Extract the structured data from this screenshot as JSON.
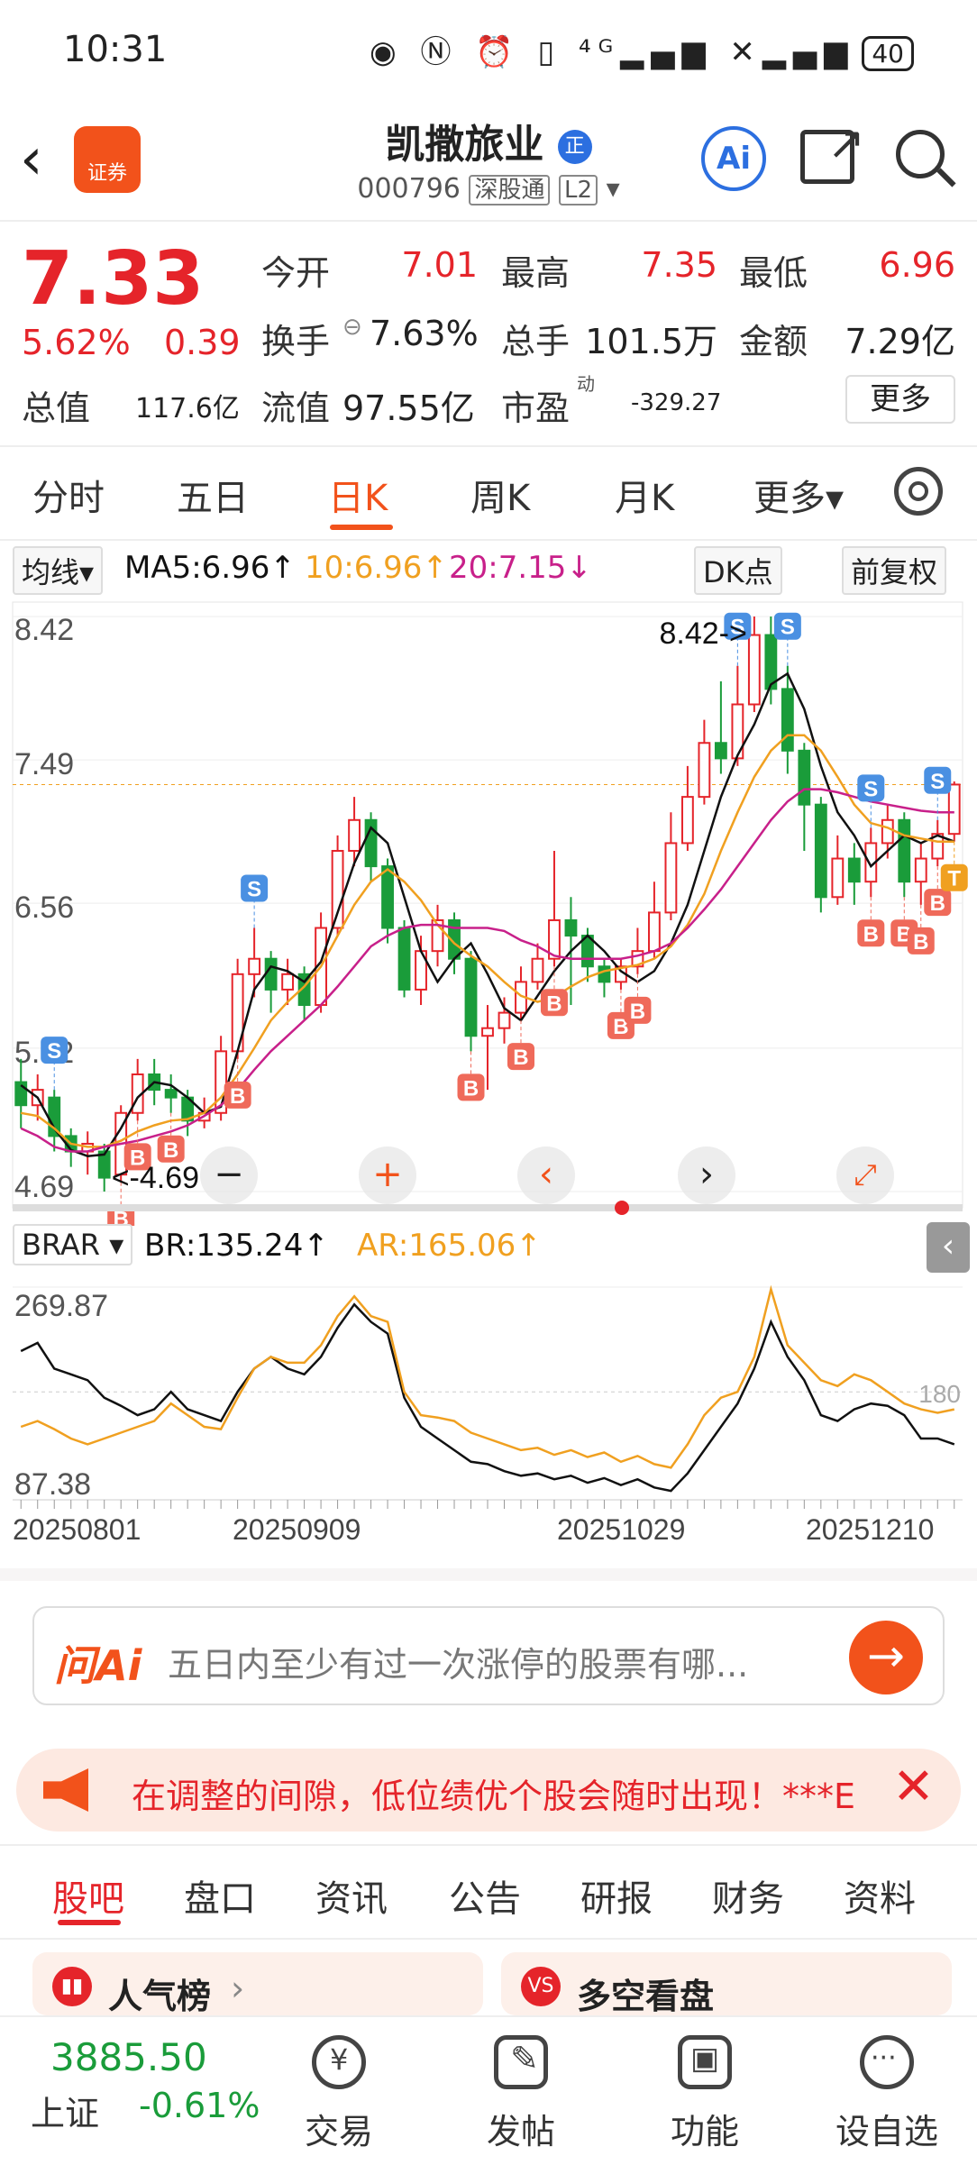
{
  "status": {
    "time": "10:31",
    "icons": "◉ Ⓝ ⏰ ▯ ⁴ᴳ▂▄▆ ✕▂▄▆",
    "battery": "40"
  },
  "header": {
    "logo_text": "证券",
    "name": "凯撒旅业",
    "name_badge": "正",
    "code": "000796",
    "market": "深股通",
    "level": "L2",
    "ai_label": "Ai"
  },
  "quote": {
    "price": "7.33",
    "change_pct": "5.62%",
    "change_abs": "0.39",
    "open_label": "今开",
    "open": "7.01",
    "high_label": "最高",
    "high": "7.35",
    "low_label": "最低",
    "low": "6.96",
    "turnover_label": "换手",
    "turnover": "7.63%",
    "volume_label": "总手",
    "volume": "101.5万",
    "amount_label": "金额",
    "amount": "7.29亿",
    "mcap_label": "总值",
    "mcap": "117.6亿",
    "float_label": "流值",
    "float": "97.55亿",
    "pe_label": "市盈",
    "pe_sup": "动",
    "pe": "-329.27",
    "more": "更多"
  },
  "tabs": [
    "分时",
    "五日",
    "日K",
    "周K",
    "月K",
    "更多▾"
  ],
  "ma": {
    "selector": "均线▾",
    "ma5": "MA5:6.96↑",
    "ma10": "10:6.96↑",
    "ma20": "20:7.15↓",
    "dk": "DK点",
    "adjust": "前复权"
  },
  "colors": {
    "up": "#e5242a",
    "down": "#1a9c3a",
    "ma5": "#111111",
    "ma10": "#f0a020",
    "ma20": "#c8208a",
    "accent": "#f2521b"
  },
  "chart_data": [
    {
      "type": "candlestick",
      "y_ticks": [
        "8.42",
        "7.49",
        "6.56",
        "5.62",
        "4.69"
      ],
      "ylim": [
        4.69,
        8.42
      ],
      "annotation_high": "8.42->",
      "annotation_low": "<-4.69",
      "series": [
        {
          "name": "MA5",
          "values": [
            5.38,
            5.3,
            5.1,
            4.96,
            4.92,
            4.93,
            5.1,
            5.3,
            5.4,
            5.38,
            5.3,
            5.2,
            5.24,
            5.6,
            6.0,
            6.15,
            6.12,
            6.05,
            6.18,
            6.5,
            6.82,
            7.05,
            6.95,
            6.6,
            6.25,
            6.05,
            6.2,
            6.3,
            6.1,
            5.88,
            5.8,
            5.96,
            6.12,
            6.25,
            6.35,
            6.25,
            6.12,
            6.05,
            6.12,
            6.3,
            6.55,
            6.9,
            7.25,
            7.52,
            7.72,
            7.98,
            8.05,
            7.82,
            7.45,
            7.15,
            7.0,
            6.8,
            6.9,
            7.0,
            6.95,
            7.0,
            6.96
          ]
        },
        {
          "name": "MA10",
          "values": [
            5.2,
            5.18,
            5.1,
            5.0,
            4.98,
            4.98,
            5.02,
            5.08,
            5.12,
            5.15,
            5.16,
            5.2,
            5.3,
            5.45,
            5.62,
            5.8,
            5.92,
            6.02,
            6.15,
            6.35,
            6.55,
            6.7,
            6.78,
            6.7,
            6.58,
            6.42,
            6.3,
            6.22,
            6.15,
            6.05,
            5.96,
            5.92,
            5.95,
            6.02,
            6.08,
            6.12,
            6.14,
            6.16,
            6.2,
            6.28,
            6.42,
            6.62,
            6.9,
            7.15,
            7.38,
            7.55,
            7.65,
            7.65,
            7.55,
            7.38,
            7.2,
            7.08,
            7.05,
            7.0,
            6.98,
            6.96,
            6.96
          ]
        },
        {
          "name": "MA20",
          "values": [
            5.1,
            5.05,
            4.98,
            4.95,
            4.95,
            4.98,
            5.0,
            5.02,
            5.05,
            5.08,
            5.12,
            5.18,
            5.25,
            5.35,
            5.48,
            5.6,
            5.7,
            5.8,
            5.9,
            6.02,
            6.15,
            6.28,
            6.35,
            6.4,
            6.42,
            6.42,
            6.4,
            6.4,
            6.4,
            6.38,
            6.32,
            6.28,
            6.22,
            6.2,
            6.2,
            6.2,
            6.2,
            6.22,
            6.25,
            6.3,
            6.4,
            6.52,
            6.65,
            6.8,
            6.95,
            7.1,
            7.22,
            7.3,
            7.3,
            7.28,
            7.25,
            7.22,
            7.2,
            7.18,
            7.16,
            7.15,
            7.15
          ]
        }
      ],
      "candles": [
        [
          5.4,
          5.25,
          5.55,
          5.1
        ],
        [
          5.25,
          5.35,
          5.45,
          5.15
        ],
        [
          5.3,
          5.05,
          5.35,
          4.95
        ],
        [
          5.05,
          4.95,
          5.1,
          4.85
        ],
        [
          4.95,
          5.0,
          5.08,
          4.8
        ],
        [
          4.95,
          4.78,
          5.0,
          4.69
        ],
        [
          4.8,
          5.2,
          5.25,
          4.75
        ],
        [
          5.2,
          5.45,
          5.55,
          5.15
        ],
        [
          5.45,
          5.35,
          5.55,
          5.25
        ],
        [
          5.35,
          5.3,
          5.45,
          5.2
        ],
        [
          5.3,
          5.15,
          5.35,
          5.05
        ],
        [
          5.15,
          5.2,
          5.3,
          5.1
        ],
        [
          5.2,
          5.6,
          5.7,
          5.15
        ],
        [
          5.6,
          6.1,
          6.2,
          5.55
        ],
        [
          6.1,
          6.2,
          6.4,
          5.95
        ],
        [
          6.2,
          6.0,
          6.25,
          5.85
        ],
        [
          6.0,
          6.1,
          6.2,
          5.9
        ],
        [
          6.1,
          5.9,
          6.15,
          5.8
        ],
        [
          5.9,
          6.4,
          6.5,
          5.85
        ],
        [
          6.4,
          6.9,
          7.0,
          6.35
        ],
        [
          6.9,
          7.1,
          7.25,
          6.8
        ],
        [
          7.1,
          6.8,
          7.15,
          6.7
        ],
        [
          6.8,
          6.4,
          6.85,
          6.3
        ],
        [
          6.4,
          6.0,
          6.45,
          5.95
        ],
        [
          6.0,
          6.25,
          6.35,
          5.9
        ],
        [
          6.25,
          6.45,
          6.55,
          6.15
        ],
        [
          6.45,
          6.2,
          6.5,
          6.1
        ],
        [
          6.2,
          5.7,
          6.25,
          5.6
        ],
        [
          5.7,
          5.75,
          5.9,
          5.35
        ],
        [
          5.75,
          5.85,
          5.95,
          5.65
        ],
        [
          5.85,
          6.05,
          6.15,
          5.8
        ],
        [
          6.05,
          6.2,
          6.3,
          6.0
        ],
        [
          6.2,
          6.45,
          6.9,
          6.15
        ],
        [
          6.45,
          6.35,
          6.6,
          5.9
        ],
        [
          6.35,
          6.15,
          6.4,
          6.05
        ],
        [
          6.15,
          6.05,
          6.2,
          5.95
        ],
        [
          6.05,
          6.15,
          6.2,
          6.0
        ],
        [
          6.15,
          6.25,
          6.4,
          6.1
        ],
        [
          6.25,
          6.5,
          6.7,
          6.2
        ],
        [
          6.5,
          6.95,
          7.15,
          6.45
        ],
        [
          6.95,
          7.25,
          7.45,
          6.9
        ],
        [
          7.25,
          7.6,
          7.75,
          7.2
        ],
        [
          7.6,
          7.5,
          8.0,
          7.4
        ],
        [
          7.5,
          7.85,
          8.1,
          7.45
        ],
        [
          7.85,
          8.3,
          8.42,
          7.8
        ],
        [
          8.3,
          7.95,
          8.42,
          7.85
        ],
        [
          7.95,
          7.55,
          8.1,
          7.4
        ],
        [
          7.55,
          7.2,
          7.6,
          6.9
        ],
        [
          7.2,
          6.6,
          7.25,
          6.5
        ],
        [
          6.6,
          6.85,
          7.0,
          6.55
        ],
        [
          6.85,
          6.7,
          6.95,
          6.55
        ],
        [
          6.7,
          6.95,
          7.05,
          6.6
        ],
        [
          6.95,
          7.1,
          7.2,
          6.85
        ],
        [
          7.1,
          6.7,
          7.15,
          6.6
        ],
        [
          6.7,
          6.85,
          6.95,
          6.55
        ],
        [
          6.85,
          7.01,
          7.1,
          6.8
        ],
        [
          7.01,
          7.33,
          7.35,
          6.96
        ]
      ],
      "signals": [
        {
          "label": "S",
          "i": 2
        },
        {
          "label": "B",
          "i": 6
        },
        {
          "label": "B",
          "i": 7
        },
        {
          "label": "B",
          "i": 9
        },
        {
          "label": "S",
          "i": 14
        },
        {
          "label": "B",
          "i": 13
        },
        {
          "label": "B",
          "i": 27
        },
        {
          "label": "B",
          "i": 30
        },
        {
          "label": "B",
          "i": 32
        },
        {
          "label": "B",
          "i": 36
        },
        {
          "label": "B",
          "i": 37
        },
        {
          "label": "S",
          "i": 43
        },
        {
          "label": "S",
          "i": 46
        },
        {
          "label": "S",
          "i": 51
        },
        {
          "label": "B",
          "i": 51
        },
        {
          "label": "B",
          "i": 53
        },
        {
          "label": "B",
          "i": 54
        },
        {
          "label": "B",
          "i": 55
        },
        {
          "label": "S",
          "i": 55
        },
        {
          "label": "T",
          "i": 56
        }
      ]
    },
    {
      "type": "line",
      "indicator": "BRAR",
      "br_label": "BR:135.24↑",
      "ar_label": "AR:165.06↑",
      "y_ticks": [
        "269.87",
        "87.38"
      ],
      "ref_line": "180",
      "ylim": [
        87.38,
        269.87
      ],
      "x_ticks": [
        "20250801",
        "20250909",
        "20251029",
        "20251210"
      ],
      "series": [
        {
          "name": "BR",
          "values": [
            215,
            222,
            200,
            195,
            190,
            175,
            168,
            160,
            165,
            180,
            165,
            160,
            155,
            180,
            200,
            210,
            200,
            195,
            210,
            235,
            255,
            240,
            230,
            175,
            150,
            140,
            130,
            120,
            118,
            112,
            108,
            110,
            105,
            108,
            102,
            106,
            100,
            105,
            98,
            95,
            110,
            130,
            150,
            170,
            200,
            240,
            210,
            190,
            160,
            155,
            165,
            170,
            168,
            160,
            140,
            140,
            135
          ]
        },
        {
          "name": "AR",
          "values": [
            150,
            155,
            148,
            140,
            135,
            140,
            145,
            150,
            155,
            170,
            160,
            150,
            148,
            175,
            200,
            210,
            205,
            205,
            220,
            245,
            262,
            245,
            240,
            180,
            160,
            158,
            155,
            145,
            140,
            135,
            130,
            132,
            126,
            130,
            124,
            128,
            120,
            125,
            118,
            115,
            135,
            160,
            175,
            180,
            210,
            268,
            220,
            205,
            190,
            185,
            195,
            190,
            180,
            170,
            165,
            162,
            165
          ]
        }
      ]
    }
  ],
  "ai_bar": {
    "logo": "问Ai",
    "placeholder": "五日内至少有过一次涨停的股票有哪..."
  },
  "banner": {
    "text": "在调整的间隙，低位绩优个股会随时出现！***E"
  },
  "subtabs": [
    "股吧",
    "盘口",
    "资讯",
    "公告",
    "研报",
    "财务",
    "资料"
  ],
  "cards": [
    {
      "title": "人气榜",
      "arrow": "›"
    },
    {
      "title": "多空看盘"
    }
  ],
  "bottom": {
    "index_value": "3885.50",
    "index_name": "上证",
    "index_change": "-0.61%",
    "items": [
      "交易",
      "发帖",
      "功能",
      "设自选"
    ]
  }
}
